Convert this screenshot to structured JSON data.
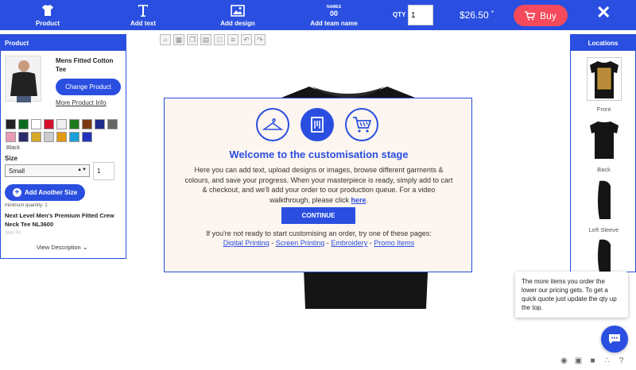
{
  "toolbar": {
    "product": "Product",
    "add_text": "Add text",
    "add_design": "Add design",
    "add_team_name": "Add team name",
    "team_icon_top": "NAMES",
    "team_icon_num": "00",
    "qty_label": "QTY",
    "qty_value": "1",
    "price": "$26.50",
    "price_mark": "*",
    "buy": "Buy"
  },
  "product_panel": {
    "title": "Product",
    "name": "Mens Fitted Cotton Tee",
    "change_button": "Change Product",
    "more_info": "More Product Info",
    "swatch_colors": [
      "#222222",
      "#0b6b1e",
      "#ffffff",
      "#d4112c",
      "#eeeeee",
      "#1e7a1e",
      "#7a3a12",
      "#202c8a",
      "#666666",
      "#e89ab6",
      "#2b2b6b",
      "#d4a82a",
      "#cccccc",
      "#e39a12",
      "#1aa0d8",
      "#2233bb"
    ],
    "selected_color": "Black",
    "size_label": "Size",
    "size_value": "Small",
    "size_qty": "1",
    "add_size_button": "Add Another Size",
    "minimum_quantity": "minimum quantity: 1",
    "full_name": "Next Level Men's Premium Fitted Crew Neck Tee NL3600",
    "fade_text": "Slim Fit",
    "view_description": "View Description"
  },
  "locations_panel": {
    "title": "Locations",
    "items": [
      "Front",
      "Back",
      "Left Sleeve"
    ]
  },
  "modal": {
    "title": "Welcome to the customisation stage",
    "body": "Here you can add text, upload designs or images, browse different garments & colours, and save your progress. When your masterpiece is ready, simply add to cart & checkout, and we'll add your order to our production queue. For a video walkthrough, please click",
    "link_here": "here",
    "continue": "CONTINUE",
    "alt_text": "If you're not ready to start customising an order, try one of these pages:",
    "links": [
      "Digital Printing",
      "Screen Printing",
      "Embroidery",
      "Promo Items"
    ],
    "sep": " - "
  },
  "tooltip": {
    "text": "The more items you order the lower our pricing gets. To get a quick quote just update the qty up the top."
  },
  "colors": {
    "brand_blue": "#2a4fe0",
    "buy_red": "#f44a5b"
  },
  "icons": [
    "tshirt-icon",
    "text-icon",
    "image-icon",
    "team-name-icon",
    "cart-icon",
    "close-icon",
    "zoom-icon",
    "chat-icon",
    "eye-icon",
    "save-icon",
    "share-icon",
    "help-icon",
    "hanger-icon",
    "design-icon",
    "cart-outline-icon",
    "plus-icon",
    "chevron-down-icon"
  ]
}
